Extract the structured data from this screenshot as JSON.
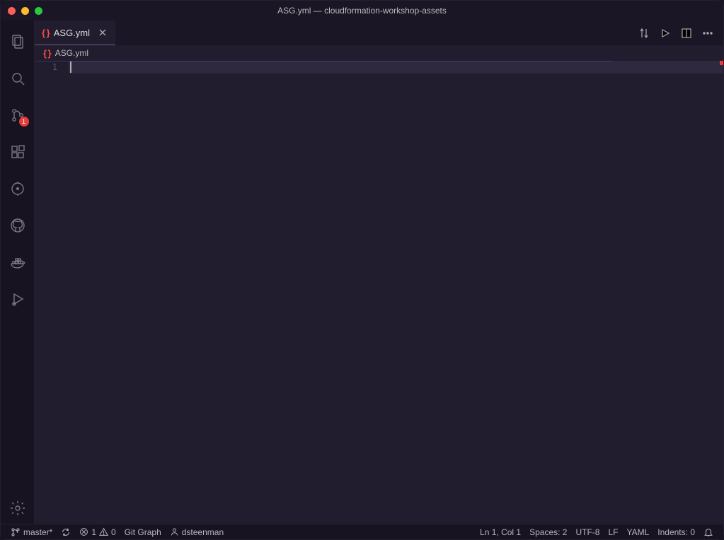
{
  "window": {
    "title": "ASG.yml — cloudformation-workshop-assets"
  },
  "tabs": [
    {
      "label": "ASG.yml",
      "active": true
    }
  ],
  "breadcrumb": {
    "file": "ASG.yml"
  },
  "editor": {
    "line_numbers": [
      "1"
    ],
    "content_line_1": ""
  },
  "activitybar": {
    "scm_badge": "1"
  },
  "statusbar": {
    "branch": "master*",
    "errors": "1",
    "warnings": "0",
    "git_graph": "Git Graph",
    "user": "dsteenman",
    "ln_col": "Ln 1, Col 1",
    "spaces": "Spaces: 2",
    "encoding": "UTF-8",
    "eol": "LF",
    "language": "YAML",
    "indents": "Indents: 0"
  }
}
